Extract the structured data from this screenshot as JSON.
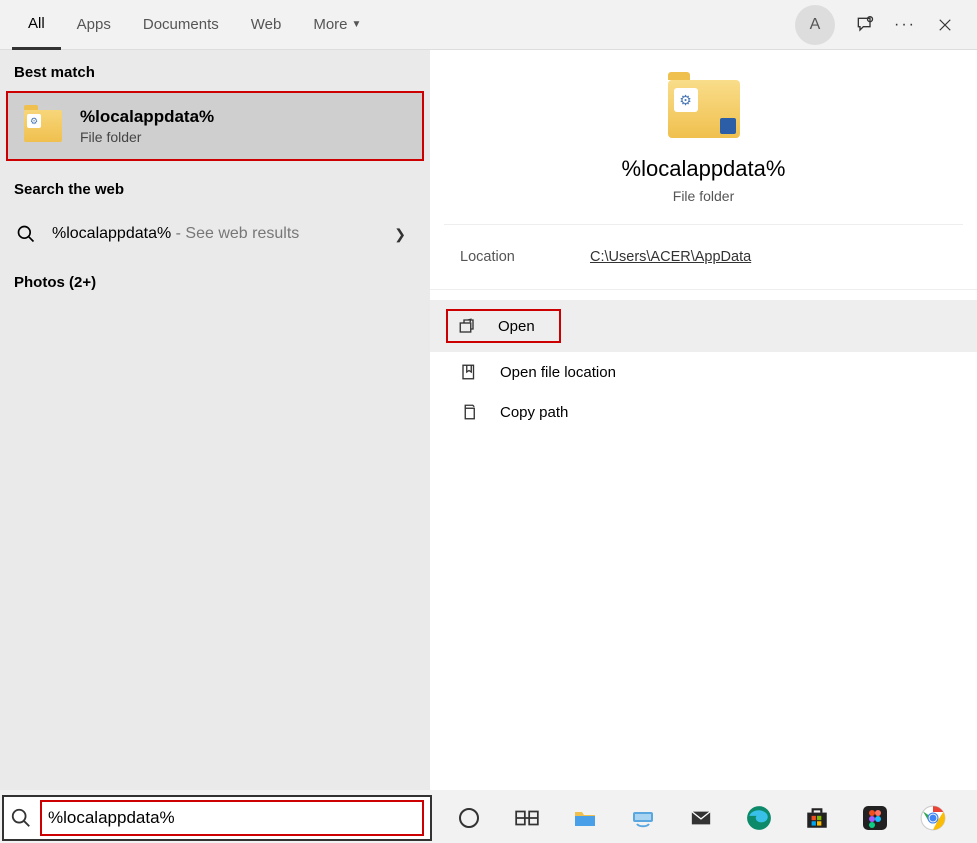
{
  "tabs": {
    "all": "All",
    "apps": "Apps",
    "documents": "Documents",
    "web": "Web",
    "more": "More"
  },
  "avatar_letter": "A",
  "left": {
    "best_match_label": "Best match",
    "best_match_title": "%localappdata%",
    "best_match_sub": "File folder",
    "search_web_label": "Search the web",
    "web_result_main": "%localappdata%",
    "web_result_suffix": " - See web results",
    "photos_label": "Photos (2+)"
  },
  "detail": {
    "title": "%localappdata%",
    "sub": "File folder",
    "location_label": "Location",
    "location_path": "C:\\Users\\ACER\\AppData",
    "actions": {
      "open": "Open",
      "open_location": "Open file location",
      "copy_path": "Copy path"
    }
  },
  "search": {
    "value": "%localappdata%"
  }
}
